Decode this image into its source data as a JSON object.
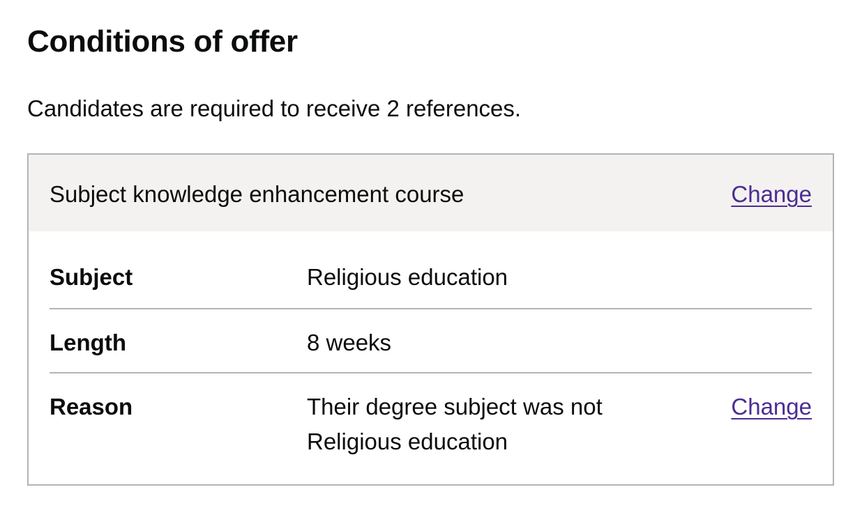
{
  "page": {
    "title": "Conditions of offer",
    "lede": "Candidates are required to receive 2 references."
  },
  "ske_card": {
    "title": "Subject knowledge enhancement course",
    "change_label": "Change",
    "rows": [
      {
        "key": "Subject",
        "value": "Religious education",
        "change_label": ""
      },
      {
        "key": "Length",
        "value": "8 weeks",
        "change_label": ""
      },
      {
        "key": "Reason",
        "value": "Their degree subject was not Religious education",
        "change_label": "Change"
      }
    ]
  },
  "colors": {
    "text": "#0b0c0c",
    "link": "#4c2c92",
    "header_bg": "#f3f2f1",
    "border": "#b1b4b6"
  }
}
